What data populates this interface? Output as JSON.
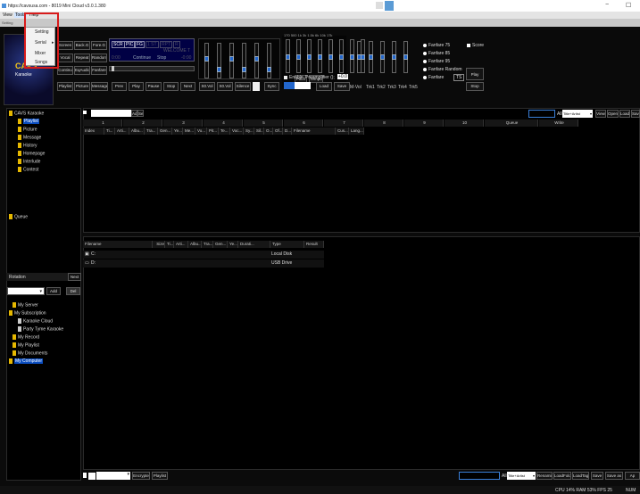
{
  "window": {
    "title": "https://cavsusa.com - 8019 Mini Cloud v3.0.1.380",
    "minimize": "−",
    "maximize": "☐"
  },
  "menu": {
    "items": [
      "View",
      "Tools",
      "Help"
    ]
  },
  "strip_text": "Setting",
  "dropdown": {
    "items": [
      "Setting",
      "Serial",
      "Mixer",
      "Songs"
    ],
    "arrow": "▸"
  },
  "logo": {
    "text": "CAVS",
    "subtext": "Karaoke"
  },
  "player": {
    "row1": [
      "Screen",
      "Back.G",
      "Fore.G"
    ],
    "row2": [
      "Vocal",
      "Repeat",
      "Random"
    ],
    "row3": [
      "Continu",
      "EqAudio",
      "Fanfare"
    ],
    "row4": [
      "Playlist",
      "Picture",
      "Message",
      "Prev",
      "Play",
      "Pause",
      "Stop",
      "Next",
      "S0.Vol",
      "S0.Vol",
      "Silence",
      "Sync"
    ],
    "display_tabs": [
      "SCR",
      "PIC",
      "FG",
      "1 ST",
      "RPT",
      "R"
    ],
    "welcome": "WELCOME T",
    "status": [
      "Continue",
      "Stop"
    ],
    "time_left": "0:00",
    "time_right": "-0:00"
  },
  "pitch": {
    "labels": [
      "Pitch",
      "Tempo"
    ],
    "enable": "Enable",
    "preamp": "Preamplifier ();",
    "preamp_value": "+0.0",
    "load": "Load",
    "save": "Save"
  },
  "eq": {
    "freqs": [
      "170",
      "500",
      "1k",
      "3k",
      "1.5k",
      "6k",
      "10k",
      "17k"
    ],
    "mvol": "M-Vol",
    "tracks": [
      "Trk1",
      "Trk2",
      "Trk3",
      "Trk4",
      "Trk5"
    ]
  },
  "fanfare": {
    "options": [
      "Fanfare 75",
      "Fanfare 85",
      "Fanfare 95",
      "Fanfare Random",
      "Fanfare"
    ],
    "ts": "TS",
    "score": "Score",
    "play": "Play",
    "stop": "Stop"
  },
  "tree": {
    "root": "CAVS Karaoke",
    "items": [
      "Playlist",
      "Picture",
      "Message",
      "History",
      "Homepage",
      "Interlude",
      "Contest"
    ],
    "queue": "Queue",
    "rotation": "Rotation",
    "next": "Next",
    "add": "Add",
    "del": "Del",
    "nav": [
      "My Server",
      "My Subscription",
      "Karaoke Cloud",
      "Party Tyme Karaoke",
      "My Record",
      "My Playlist",
      "My Documents",
      "My Computer"
    ]
  },
  "playlist": {
    "add": "Add",
    "sel": "Sel",
    "tabs": [
      "1",
      "2",
      "3",
      "4",
      "5",
      "6",
      "7",
      "8",
      "9",
      "10",
      "Queue",
      "Write"
    ],
    "columns": [
      "Index",
      "Ti...",
      "Arti...",
      "Albu...",
      "Tra...",
      "Gen...",
      "Ye...",
      "Me...",
      "Vo...",
      "Pit...",
      "Te...",
      "Voc...",
      "Sy...",
      "Sil...",
      "O...",
      "Of...",
      "D...",
      "Filename",
      "Cus...",
      "Lang..."
    ],
    "all": "All",
    "sort": "Title+Artist",
    "actions": [
      "View",
      "Open",
      "Load",
      "Save",
      "Save as",
      "Ap"
    ]
  },
  "browser": {
    "columns": [
      "Filename",
      "Size",
      "Ti...",
      "Arti...",
      "Albu...",
      "Tra...",
      "Gen...",
      "Ye...",
      "Durati...",
      "Type",
      "Result"
    ],
    "rows": [
      {
        "name": "C:",
        "type": "Local Disk"
      },
      {
        "name": "D:",
        "type": "USB Drive"
      }
    ]
  },
  "bottom": {
    "encrypte": "Encrypte",
    "playlist": "Playlist",
    "all": "All",
    "sort": "Title+Artist",
    "actions": [
      "Renaming",
      "LoadFold",
      "LoadTag",
      "Save",
      "Save as",
      "Ap"
    ]
  },
  "status": {
    "perf": "CPU 14% RAM 53% FPS 25",
    "num": "NUM"
  },
  "colors": {
    "accent": "#0b4dbf",
    "highlight": "#d81b1b",
    "folder": "#e6b800",
    "knob": "#2266cc"
  }
}
